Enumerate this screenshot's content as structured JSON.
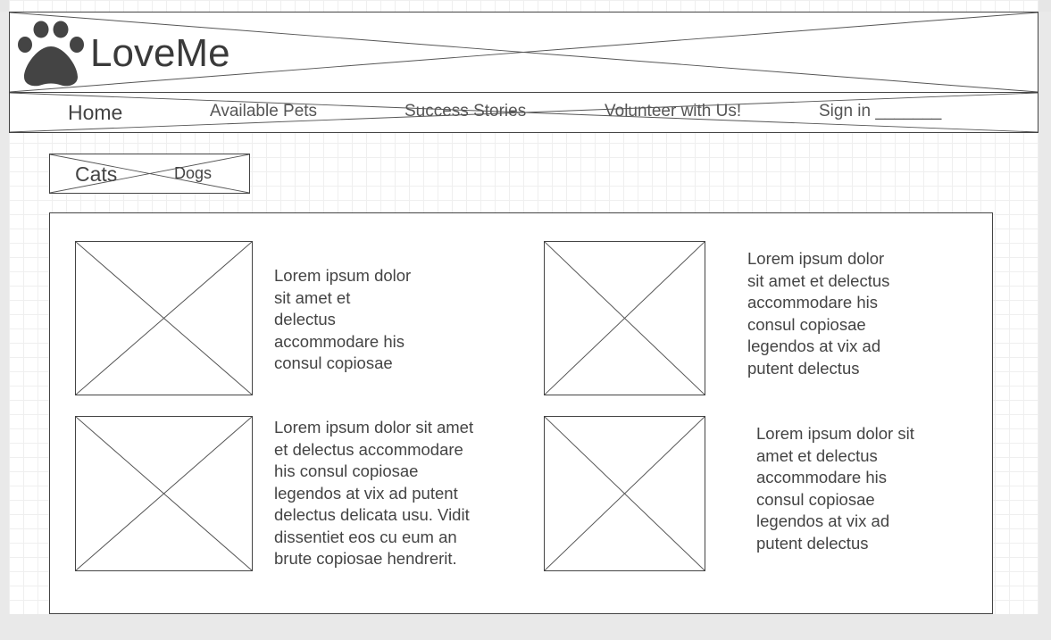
{
  "brand": {
    "logo_icon": "paw-icon",
    "name": "LoveMe"
  },
  "nav": {
    "items": [
      {
        "label": "Home"
      },
      {
        "label": "Available Pets"
      },
      {
        "label": "Success Stories"
      },
      {
        "label": "Volunteer with Us!"
      },
      {
        "label": "Sign in _______"
      }
    ]
  },
  "tabs": [
    {
      "label": "Cats"
    },
    {
      "label": "Dogs"
    }
  ],
  "cards": [
    {
      "image": "placeholder-image",
      "text": "Lorem ipsum dolor\nsit amet et\ndelectus\naccommodare his\nconsul copiosae"
    },
    {
      "image": "placeholder-image",
      "text": "Lorem ipsum dolor\nsit amet et delectus\naccommodare his\nconsul copiosae\nlegendos at vix ad\nputent delectus"
    },
    {
      "image": "placeholder-image",
      "text": "Lorem ipsum dolor sit amet\net delectus accommodare\nhis consul copiosae\nlegendos at vix ad putent\ndelectus delicata usu. Vidit\ndissentiet eos cu eum an\nbrute copiosae hendrerit."
    },
    {
      "image": "placeholder-image",
      "text": "Lorem ipsum dolor sit\namet et delectus\naccommodare his\nconsul copiosae\nlegendos at vix ad\nputent delectus"
    }
  ]
}
